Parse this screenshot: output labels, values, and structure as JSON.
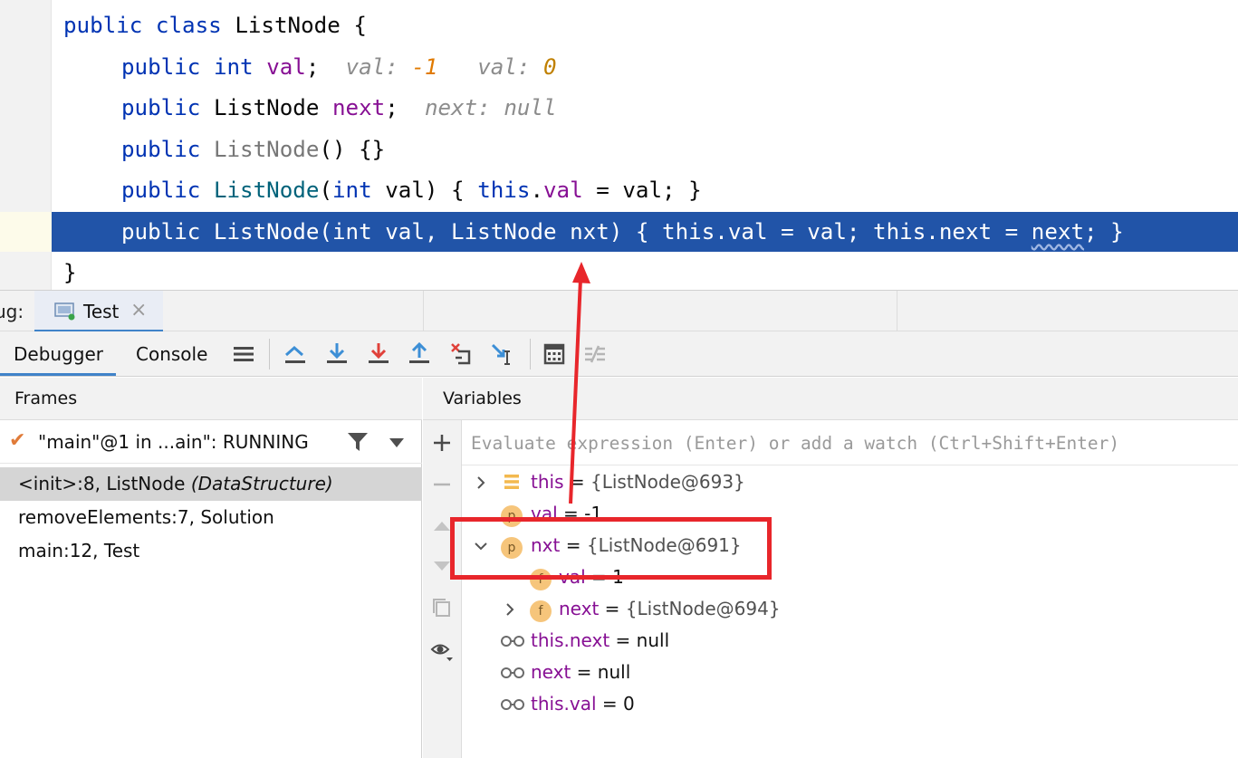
{
  "editor": {
    "lines": [
      {
        "kw": "public class",
        "name": "ListNode",
        "rest": " {"
      },
      {
        "kw1": "public",
        "kw2": "int",
        "field": "val",
        "rest": ";",
        "hint1_label": "val:",
        "hint1_value": "-1",
        "hint2_label": "val:",
        "hint2_value": "0"
      },
      {
        "kw": "public",
        "type": "ListNode",
        "field": "next",
        "rest": ";",
        "hint_label": "next:",
        "hint_value": "null"
      },
      {
        "kw": "public",
        "ctor": "ListNode",
        "rest": "() {}"
      },
      {
        "kw": "public",
        "ctor": "ListNode",
        "p1": "(",
        "kw2": "int",
        "p2": " val) { ",
        "kw3": "this",
        "p3": ".",
        "field": "val",
        "p4": " = val; }"
      },
      {
        "text_a": "public ListNode(int val, ListNode nxt) { this.val = val; this.next = ",
        "text_b": "next",
        "text_c": "; }"
      },
      {
        "text": "}"
      }
    ]
  },
  "debug": {
    "label": "ug:",
    "run_tab": "Test",
    "close_glyph": "×",
    "tabs": {
      "debugger": "Debugger",
      "console": "Console"
    }
  },
  "frames": {
    "title": "Frames",
    "thread": "\"main\"@1 in ...ain\": RUNNING",
    "items": [
      {
        "method": "<init>:8, ListNode ",
        "pkg": "(DataStructure)"
      },
      {
        "method": "removeElements:7, Solution",
        "pkg": ""
      },
      {
        "method": "main:12, Test",
        "pkg": ""
      }
    ]
  },
  "variables": {
    "title": "Variables",
    "eval_placeholder": "Evaluate expression (Enter) or add a watch (Ctrl+Shift+Enter)",
    "rows": [
      {
        "name": "this",
        "eq": " = ",
        "value": "{ListNode@693}",
        "badge": ""
      },
      {
        "name": "val",
        "eq": " = ",
        "value": "-1",
        "badge": "p"
      },
      {
        "name": "nxt",
        "eq": " = ",
        "value": "{ListNode@691}",
        "badge": "p"
      },
      {
        "name": "val",
        "eq": " = ",
        "value": "1",
        "badge": "f"
      },
      {
        "name": "next",
        "eq": " = ",
        "value": "{ListNode@694}",
        "badge": "f"
      },
      {
        "name": "this.next",
        "eq": " = ",
        "value": "null",
        "badge": ""
      },
      {
        "name": "next",
        "eq": " = ",
        "value": "null",
        "badge": ""
      },
      {
        "name": "this.val",
        "eq": " = ",
        "value": "0",
        "badge": ""
      }
    ]
  },
  "colors": {
    "highlight": "#2154a8",
    "annotation_red": "#e8262b",
    "keyword": "#0033b3",
    "field": "#871094",
    "accent": "#4083c9"
  }
}
